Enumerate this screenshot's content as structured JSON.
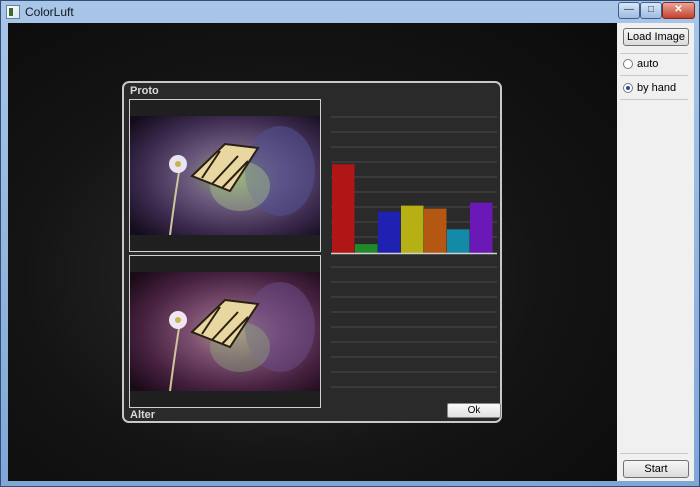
{
  "window": {
    "title": "ColorLuft",
    "icon": "app-icon",
    "controls": [
      "minimize-icon",
      "maximize-icon",
      "close-icon"
    ]
  },
  "sidebar": {
    "load_label": "Load Image",
    "options": [
      {
        "label": "auto",
        "selected": false
      },
      {
        "label": "by hand",
        "selected": true
      }
    ],
    "start_label": "Start"
  },
  "dialog": {
    "proto_label": "Proto",
    "alter_label": "Alter",
    "ok_label": "Ok"
  },
  "chart_data": {
    "type": "bar",
    "categories": [
      "red",
      "green",
      "blue",
      "yellow",
      "orange",
      "cyan",
      "purple"
    ],
    "values": [
      30,
      3,
      14,
      16,
      15,
      8,
      17
    ],
    "ylim": [
      0,
      50
    ],
    "colors": [
      "#b01616",
      "#1f8a2a",
      "#1f22b0",
      "#b6b015",
      "#b35712",
      "#138aa8",
      "#6a18b6"
    ],
    "grid": true
  }
}
